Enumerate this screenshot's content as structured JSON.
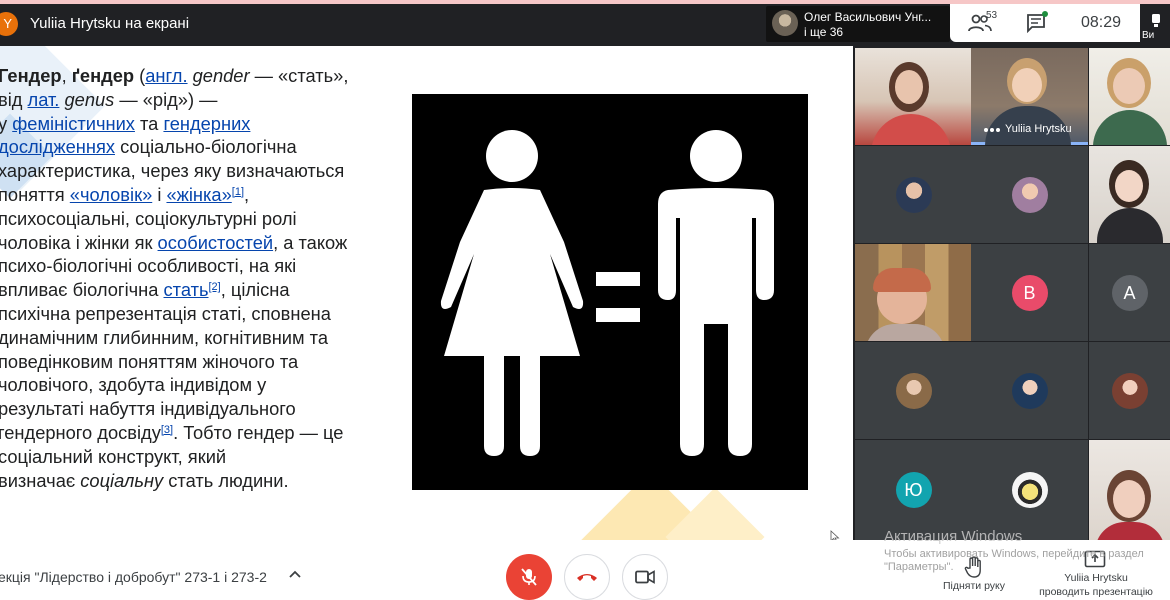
{
  "top_bar": {
    "presenter_initial": "Y",
    "presenting_label": "Yuliia Hrytsku на екрані",
    "active_speaker_name": "Олег Васильович Унг...",
    "active_speaker_others": "і ще 36",
    "participants_count": "53",
    "clock": "08:29",
    "user_label": "Ви"
  },
  "slide": {
    "lines": [
      [
        {
          "t": "Гендер",
          "b": true
        },
        {
          "t": ", "
        },
        {
          "t": "ґендер",
          "b": true
        },
        {
          "t": " ("
        },
        {
          "t": "англ.",
          "l": true
        },
        {
          "t": " "
        },
        {
          "t": "gender",
          "i": true
        },
        {
          "t": " — «стать»,"
        }
      ],
      [
        {
          "t": "від "
        },
        {
          "t": "лат.",
          "l": true
        },
        {
          "t": " "
        },
        {
          "t": "genus",
          "i": true
        },
        {
          "t": " — «рід») —"
        }
      ],
      [
        {
          "t": "у "
        },
        {
          "t": "феміністичних",
          "l": true
        },
        {
          "t": " та "
        },
        {
          "t": "гендерних",
          "l": true
        }
      ],
      [
        {
          "t": "дослідженнях",
          "l": true
        },
        {
          "t": " соціально-біологічна"
        }
      ],
      [
        {
          "t": "характеристика, через яку визначаються"
        }
      ],
      [
        {
          "t": "поняття "
        },
        {
          "t": "«чоловік»",
          "l": true
        },
        {
          "t": " і "
        },
        {
          "t": "«жінка»",
          "l": true
        },
        {
          "t": "[1]",
          "s": true
        },
        {
          "t": ","
        }
      ],
      [
        {
          "t": "психосоціальні, соціокультурні ролі"
        }
      ],
      [
        {
          "t": "чоловіка і жінки як "
        },
        {
          "t": "особистостей",
          "l": true
        },
        {
          "t": ", а також"
        }
      ],
      [
        {
          "t": "психо-біологічні особливості, на які"
        }
      ],
      [
        {
          "t": "впливає біологічна "
        },
        {
          "t": "стать",
          "l": true
        },
        {
          "t": "[2]",
          "s": true
        },
        {
          "t": ", цілісна"
        }
      ],
      [
        {
          "t": "психічна репрезентація статі, сповнена"
        }
      ],
      [
        {
          "t": "динамічним глибинним, когнітивним та"
        }
      ],
      [
        {
          "t": "поведінковим поняттям жіночого та"
        }
      ],
      [
        {
          "t": "чоловічого, здобута індивідом у"
        }
      ],
      [
        {
          "t": "результаті набуття індивідуального"
        }
      ],
      [
        {
          "t": "гендерного досвіду"
        },
        {
          "t": "[3]",
          "s": true
        },
        {
          "t": ". Тобто гендер — це"
        }
      ],
      [
        {
          "t": "соціальний конструкт, який"
        }
      ],
      [
        {
          "t": "визначає "
        },
        {
          "t": "соціальну",
          "i": true
        },
        {
          "t": " стать людини."
        }
      ]
    ]
  },
  "participants": {
    "presenter_tile_name": "Yuliia Hrytsku",
    "letter_b": "B",
    "letter_a": "A",
    "letter_yu": "Ю"
  },
  "bottom_bar": {
    "meeting_title": "екція \"Лідерство і добробут\" 273-1 і 273-2",
    "raise_hand_label": "Підняти руку",
    "presenter_name": "Yuliia Hrytsku",
    "presenting_caption": "проводить презентацію"
  },
  "watermark": {
    "title": "Активация Windows",
    "line1": "Чтобы активировать Windows, перейдите в раздел",
    "line2": "\"Параметры\"."
  },
  "colors": {
    "presenter_avatar": "#e8710a",
    "mic_off": "#ea4335",
    "hangup_icon": "#d93025",
    "link": "#0645ad",
    "letter_b": "#e94b6a",
    "letter_a": "#5f6368",
    "letter_yu": "#12a4af"
  }
}
